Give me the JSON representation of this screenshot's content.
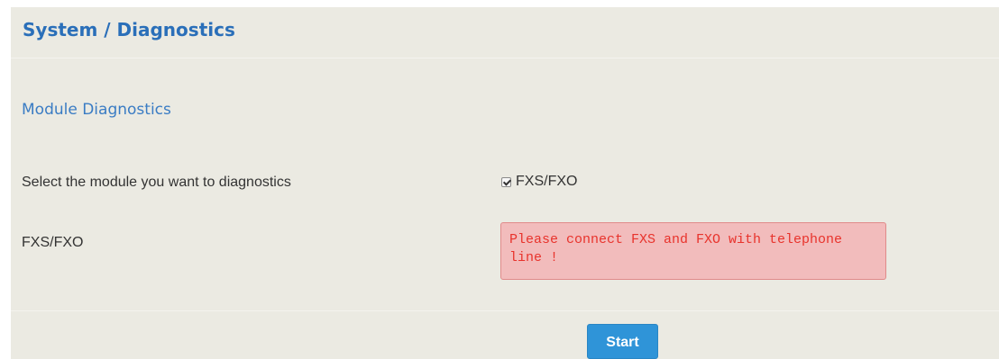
{
  "header": {
    "title": "System / Diagnostics"
  },
  "section": {
    "title": "Module Diagnostics"
  },
  "form": {
    "select_module_label": "Select the module you want to diagnostics",
    "module_option": {
      "label": "FXS/FXO",
      "checked": true
    },
    "result_label": "FXS/FXO",
    "result_message": "Please connect FXS and FXO with telephone line !"
  },
  "actions": {
    "start_label": "Start"
  },
  "colors": {
    "title": "#2a6fb9",
    "background": "#ebeae2",
    "error_bg": "#f2bcbc",
    "error_text": "#e8332c",
    "button": "#2f94d8"
  }
}
